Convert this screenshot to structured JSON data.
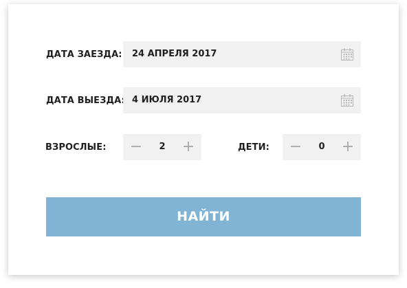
{
  "form": {
    "checkin": {
      "label": "ДАТА ЗАЕЗДА:",
      "value": "24 АПРЕЛЯ 2017",
      "icon": "calendar-icon"
    },
    "checkout": {
      "label": "ДАТА ВЫЕЗДА:",
      "value": "4 ИЮЛЯ 2017",
      "icon": "calendar-icon"
    },
    "adults": {
      "label": "ВЗРОСЛЫЕ:",
      "minus": "−",
      "value": "2",
      "plus": "+"
    },
    "children": {
      "label": "ДЕТИ:",
      "minus": "−",
      "value": "0",
      "plus": "+"
    },
    "submit_label": "НАЙТИ"
  },
  "colors": {
    "field_bg": "#f1f1f1",
    "button_bg": "#80b3d4",
    "button_text": "#ffffff",
    "stepper_glyph": "#a9a9a9"
  }
}
